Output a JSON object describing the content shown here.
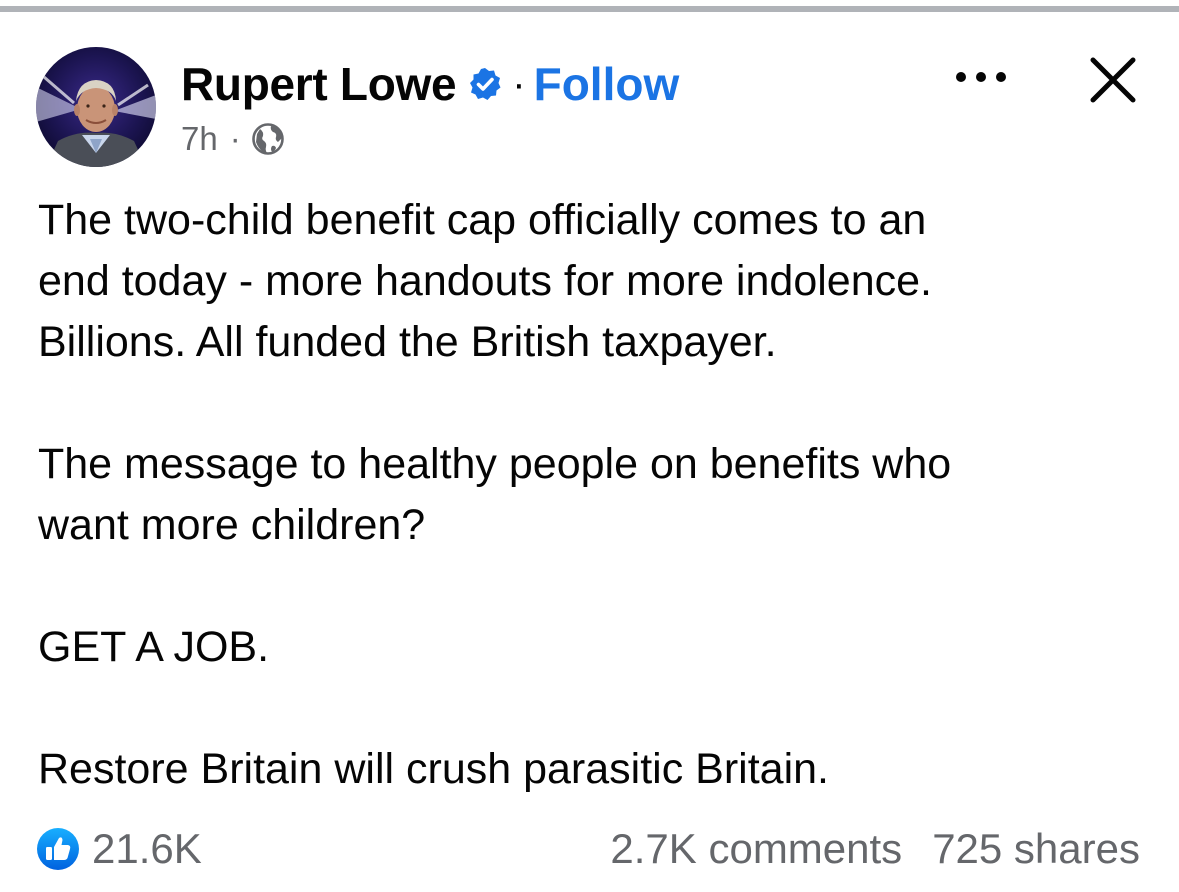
{
  "author": {
    "name": "Rupert Lowe",
    "follow_label": "Follow",
    "separator": "·",
    "timestamp": "7h",
    "audience_icon": "globe-icon",
    "verified_icon": "verified-badge-icon"
  },
  "header_actions": {
    "more_icon": "more-options-icon",
    "close_icon": "close-icon"
  },
  "post": {
    "paragraphs": [
      {
        "lines": [
          "The two-child benefit cap officially comes to an",
          "end today - more handouts for more indolence.",
          "Billions. All funded the British taxpayer."
        ]
      },
      {
        "lines": [
          "The message to healthy people on benefits who",
          "want more children?"
        ]
      },
      {
        "lines": [
          "GET A JOB."
        ]
      },
      {
        "lines": [
          "Restore Britain will crush parasitic Britain."
        ]
      }
    ]
  },
  "engagement": {
    "reaction_icon": "like-icon",
    "reactions_count": "21.6K",
    "comments_count": "2.7K comments",
    "shares_count": "725 shares"
  },
  "colors": {
    "follow_blue": "#1b74e4",
    "verified_blue": "#1b74e4",
    "secondary_text": "#65676b",
    "primary_text": "#050505"
  }
}
